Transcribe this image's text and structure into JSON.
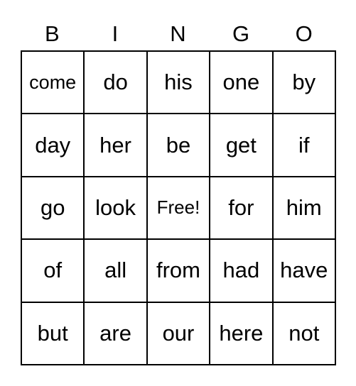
{
  "header": [
    "B",
    "I",
    "N",
    "G",
    "O"
  ],
  "rows": [
    [
      "come",
      "do",
      "his",
      "one",
      "by"
    ],
    [
      "day",
      "her",
      "be",
      "get",
      "if"
    ],
    [
      "go",
      "look",
      "Free!",
      "for",
      "him"
    ],
    [
      "of",
      "all",
      "from",
      "had",
      "have"
    ],
    [
      "but",
      "are",
      "our",
      "here",
      "not"
    ]
  ]
}
